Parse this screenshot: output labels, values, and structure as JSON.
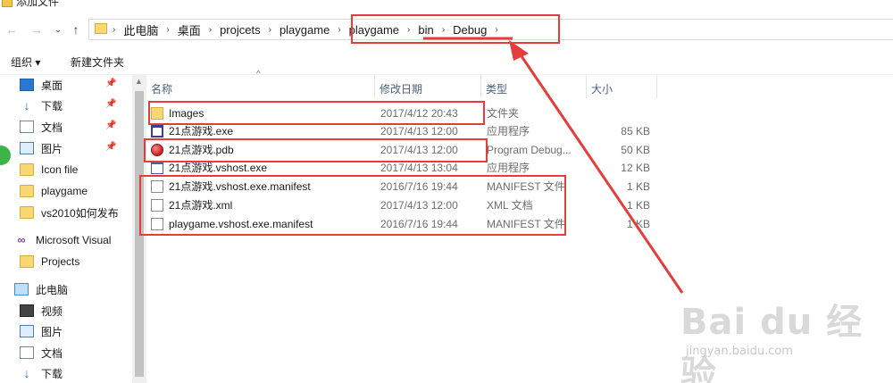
{
  "window": {
    "title": "添加文件"
  },
  "nav": {
    "back": "←",
    "forward": "→",
    "history": "⌄",
    "up": "↑"
  },
  "breadcrumb": {
    "separator": "›",
    "items": [
      "此电脑",
      "桌面",
      "projcets",
      "playgame",
      "playgame",
      "bin",
      "Debug"
    ],
    "dropdown": "›"
  },
  "toolbar": {
    "organize": "组织 ▾",
    "new_folder": "新建文件夹"
  },
  "sidebar": {
    "pin_glyph": "📌",
    "quick_access": [
      {
        "label": "桌面",
        "icon": "desktop-icon",
        "pinned": true
      },
      {
        "label": "下载",
        "icon": "download-icon",
        "pinned": true
      },
      {
        "label": "文档",
        "icon": "document-icon",
        "pinned": true
      },
      {
        "label": "图片",
        "icon": "picture-icon",
        "pinned": true
      },
      {
        "label": "Icon file",
        "icon": "folder-icon",
        "pinned": false
      },
      {
        "label": "playgame",
        "icon": "folder-icon",
        "pinned": false
      },
      {
        "label": "vs2010如何发布",
        "icon": "folder-icon",
        "pinned": false
      }
    ],
    "microsoft_visual": {
      "label": "Microsoft Visual",
      "icon": "visual-studio-icon"
    },
    "projects": {
      "label": "Projects",
      "icon": "folder-icon"
    },
    "this_pc": {
      "label": "此电脑",
      "icon": "computer-icon"
    },
    "pc_items": [
      {
        "label": "视频",
        "icon": "video-icon"
      },
      {
        "label": "图片",
        "icon": "picture-icon"
      },
      {
        "label": "文档",
        "icon": "document-icon"
      },
      {
        "label": "下载",
        "icon": "download-icon"
      }
    ]
  },
  "columns": {
    "name": "名称",
    "date": "修改日期",
    "type": "类型",
    "size": "大小",
    "sort_indicator": "^"
  },
  "files": [
    {
      "name": "Images",
      "date": "2017/4/12 20:43",
      "type": "文件夹",
      "size": "",
      "icon": "folder-icon"
    },
    {
      "name": "21点游戏.exe",
      "date": "2017/4/13 12:00",
      "type": "应用程序",
      "size": "85 KB",
      "icon": "exe-icon"
    },
    {
      "name": "21点游戏.pdb",
      "date": "2017/4/13 12:00",
      "type": "Program Debug...",
      "size": "50 KB",
      "icon": "pdb-icon"
    },
    {
      "name": "21点游戏.vshost.exe",
      "date": "2017/4/13 13:04",
      "type": "应用程序",
      "size": "12 KB",
      "icon": "vshost-exe-icon"
    },
    {
      "name": "21点游戏.vshost.exe.manifest",
      "date": "2016/7/16 19:44",
      "type": "MANIFEST 文件",
      "size": "1 KB",
      "icon": "file-icon"
    },
    {
      "name": "21点游戏.xml",
      "date": "2017/4/13 12:00",
      "type": "XML 文档",
      "size": "1 KB",
      "icon": "file-icon"
    },
    {
      "name": "playgame.vshost.exe.manifest",
      "date": "2016/7/16 19:44",
      "type": "MANIFEST 文件",
      "size": "1 KB",
      "icon": "file-icon"
    }
  ],
  "watermark": {
    "brand": "Bai du 经验",
    "url": "jingyan.baidu.com"
  },
  "annotation": {
    "color": "#e53c3c"
  }
}
